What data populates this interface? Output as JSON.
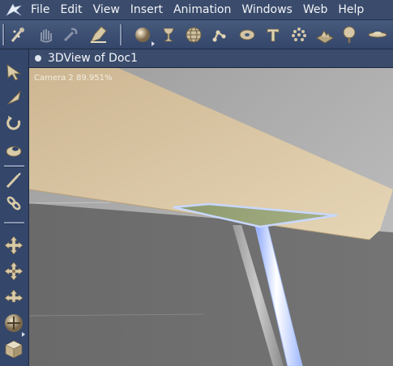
{
  "menubar": {
    "logo": "app-logo",
    "items": [
      "File",
      "Edit",
      "View",
      "Insert",
      "Animation",
      "Windows",
      "Web",
      "Help"
    ]
  },
  "toolbar": {
    "icons": [
      "hand-tool-icon",
      "grab-icon",
      "link-icon",
      "paint-icon",
      "sphere-icon",
      "lathe-icon",
      "globe-icon",
      "skeleton-icon",
      "torus-icon",
      "text-icon",
      "particles-icon",
      "terrain-icon",
      "tree-icon",
      "disc-icon"
    ]
  },
  "left_tools": {
    "icons": [
      "select-arrow-icon",
      "move-3d-icon",
      "rotate-icon",
      "scale-icon",
      "pen-icon",
      "link-tool-icon",
      "pan-icon",
      "dolly-icon",
      "orbit-icon",
      "trackball-icon",
      "render-area-icon"
    ]
  },
  "view": {
    "title": "3DView of Doc1",
    "camera_label": "Camera 2 89.951%"
  },
  "colors": {
    "menubar": "#3a4b6b",
    "sky": "#a8a8a8",
    "plane": "#dcc8a2",
    "ground": "#6e6e6e",
    "selection": "#bcd0ff"
  }
}
